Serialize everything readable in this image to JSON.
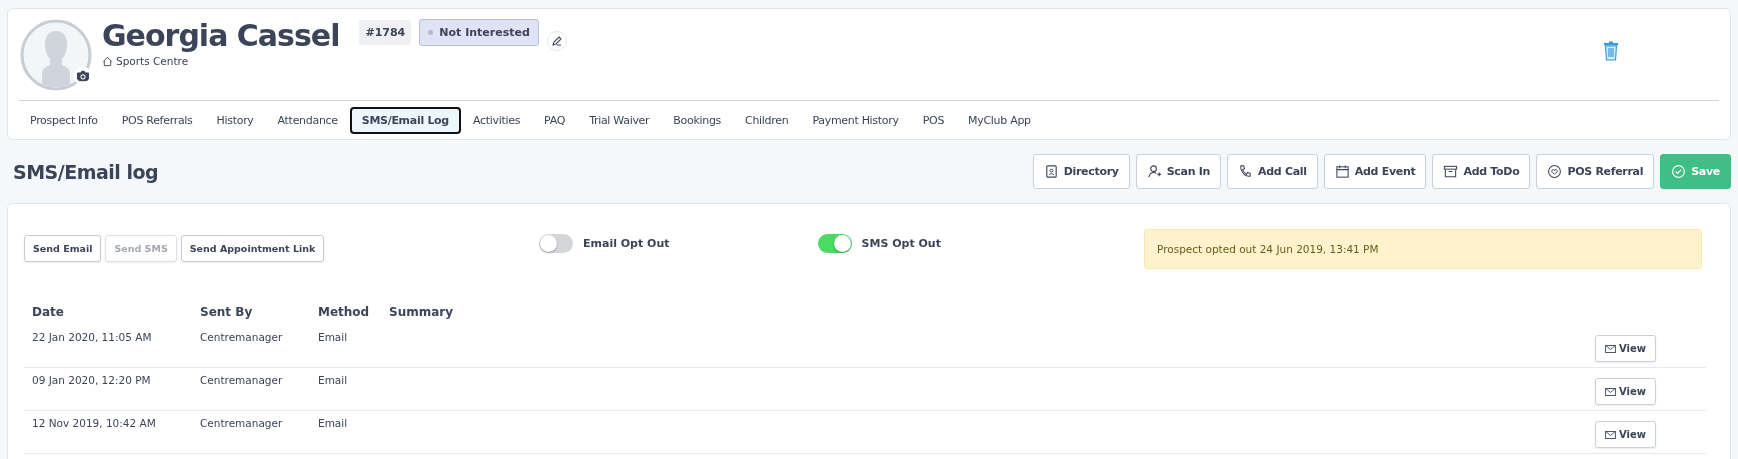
{
  "profile": {
    "name": "Georgia Cassel",
    "id_badge": "#1784",
    "status": "Not Interested",
    "location": "Sports Centre"
  },
  "tabs": [
    {
      "label": "Prospect Info",
      "selected": false
    },
    {
      "label": "POS Referrals",
      "selected": false
    },
    {
      "label": "History",
      "selected": false
    },
    {
      "label": "Attendance",
      "selected": false
    },
    {
      "label": "SMS/Email Log",
      "selected": true
    },
    {
      "label": "Activities",
      "selected": false
    },
    {
      "label": "PAQ",
      "selected": false
    },
    {
      "label": "Trial Waiver",
      "selected": false
    },
    {
      "label": "Bookings",
      "selected": false
    },
    {
      "label": "Children",
      "selected": false
    },
    {
      "label": "Payment History",
      "selected": false
    },
    {
      "label": "POS",
      "selected": false
    },
    {
      "label": "MyClub App",
      "selected": false
    }
  ],
  "page_title": "SMS/Email log",
  "actions": [
    {
      "label": "Directory",
      "kind": "directory"
    },
    {
      "label": "Scan In",
      "kind": "scan"
    },
    {
      "label": "Add Call",
      "kind": "call"
    },
    {
      "label": "Add Event",
      "kind": "event"
    },
    {
      "label": "Add ToDo",
      "kind": "todo"
    },
    {
      "label": "POS Referral",
      "kind": "referral"
    },
    {
      "label": "Save",
      "kind": "save"
    }
  ],
  "send_buttons": [
    {
      "label": "Send Email",
      "disabled": false
    },
    {
      "label": "Send SMS",
      "disabled": true
    },
    {
      "label": "Send Appointment Link",
      "disabled": false
    }
  ],
  "toggles": [
    {
      "label": "Email Opt Out",
      "on": false
    },
    {
      "label": "SMS Opt Out",
      "on": true
    }
  ],
  "notice": "Prospect opted out 24 Jun 2019, 13:41 PM",
  "table": {
    "columns": [
      "Date",
      "Sent By",
      "Method",
      "Summary"
    ],
    "rows": [
      {
        "date": "22 Jan 2020, 11:05 AM",
        "sent_by": "Centremanager",
        "method": "Email",
        "action": "View"
      },
      {
        "date": "09 Jan 2020, 12:20 PM",
        "sent_by": "Centremanager",
        "method": "Email",
        "action": "View"
      },
      {
        "date": "12 Nov 2019, 10:42 AM",
        "sent_by": "Centremanager",
        "method": "Email",
        "action": "View"
      }
    ]
  }
}
